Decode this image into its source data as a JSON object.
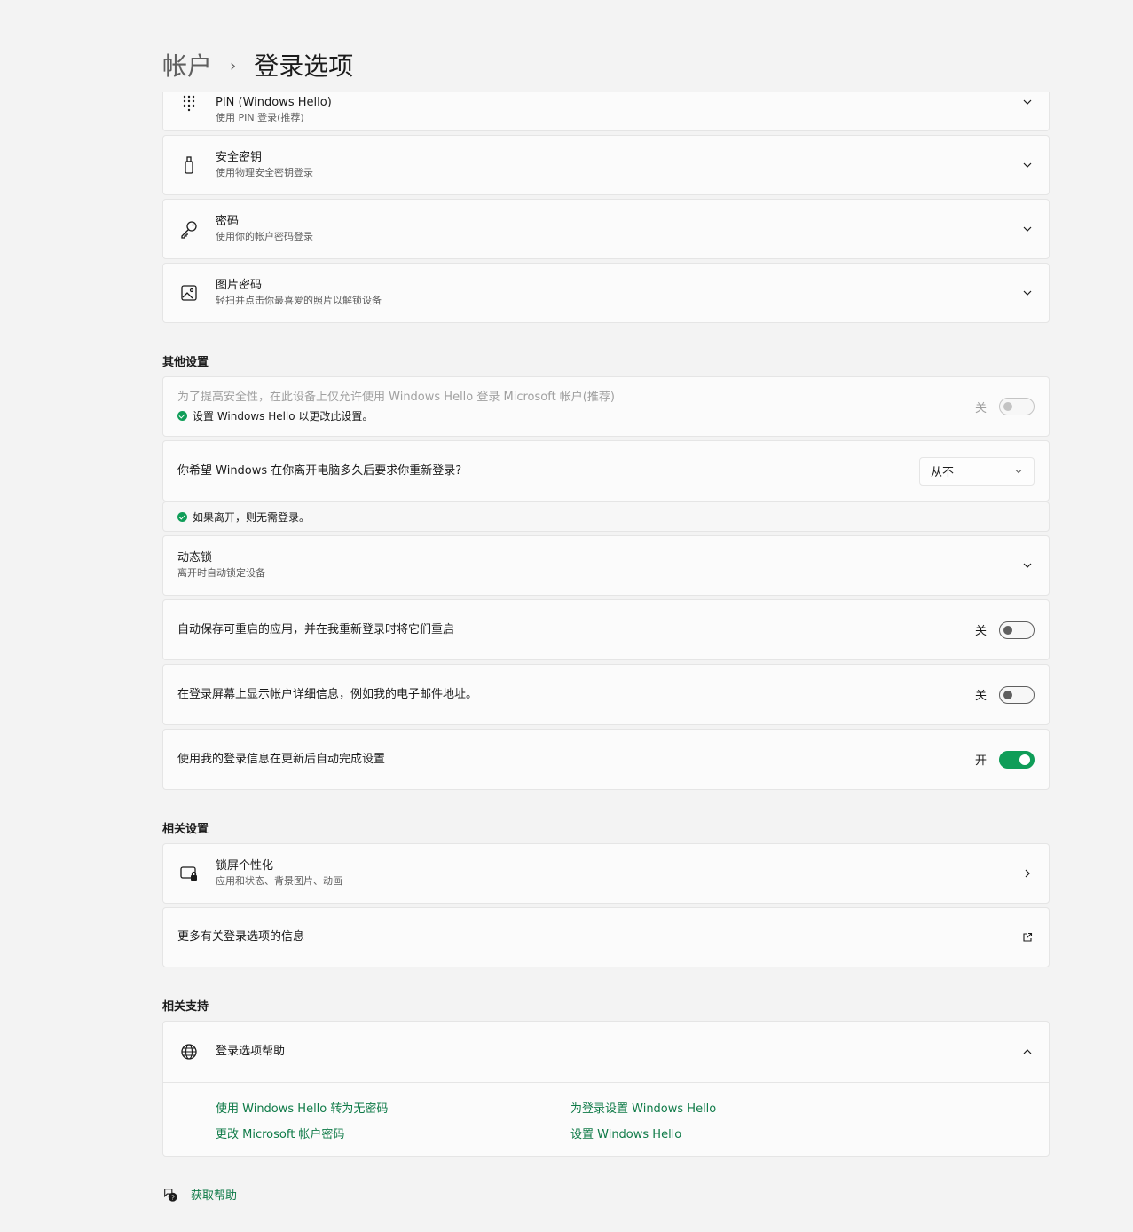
{
  "breadcrumb": {
    "parent": "帐户",
    "separator": "›",
    "current": "登录选项"
  },
  "signin_methods": [
    {
      "title": "PIN (Windows Hello)",
      "subtitle": "使用 PIN 登录(推荐)",
      "icon": "pin-keypad-icon"
    },
    {
      "title": "安全密钥",
      "subtitle": "使用物理安全密钥登录",
      "icon": "usb-key-icon"
    },
    {
      "title": "密码",
      "subtitle": "使用你的帐户密码登录",
      "icon": "key-icon"
    },
    {
      "title": "图片密码",
      "subtitle": "轻扫并点击你最喜爱的照片以解锁设备",
      "icon": "picture-icon"
    }
  ],
  "other_settings": {
    "heading": "其他设置",
    "hello_only": {
      "title": "为了提高安全性，在此设备上仅允许使用 Windows Hello 登录 Microsoft 帐户(推荐)",
      "note": "设置 Windows Hello 以更改此设置。",
      "state_label": "关",
      "enabled": false
    },
    "require_signin": {
      "question": "你希望 Windows 在你离开电脑多久后要求你重新登录?",
      "selected": "从不",
      "note": "如果离开，则无需登录。"
    },
    "dynamic_lock": {
      "title": "动态锁",
      "subtitle": "离开时自动锁定设备"
    },
    "restart_apps": {
      "title": "自动保存可重启的应用，并在我重新登录时将它们重启",
      "state_label": "关",
      "on": false
    },
    "show_details": {
      "title": "在登录屏幕上显示帐户详细信息，例如我的电子邮件地址。",
      "state_label": "关",
      "on": false
    },
    "use_signin_info": {
      "title": "使用我的登录信息在更新后自动完成设置",
      "state_label": "开",
      "on": true
    }
  },
  "related_settings": {
    "heading": "相关设置",
    "lock_screen": {
      "title": "锁屏个性化",
      "subtitle": "应用和状态、背景图片、动画"
    },
    "more_info": {
      "title": "更多有关登录选项的信息"
    }
  },
  "related_support": {
    "heading": "相关支持",
    "help": {
      "title": "登录选项帮助",
      "links": [
        "使用 Windows Hello 转为无密码",
        "为登录设置 Windows Hello",
        "更改 Microsoft 帐户密码",
        "设置 Windows Hello"
      ]
    }
  },
  "get_help": "获取帮助",
  "colors": {
    "accent": "#0f9d58",
    "link": "#0e7a47",
    "background": "#f3f3f3",
    "card": "#fbfbfb"
  }
}
